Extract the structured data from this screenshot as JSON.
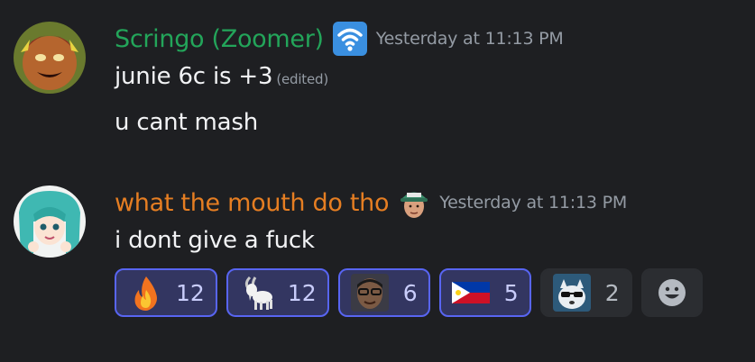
{
  "messages": [
    {
      "username": "Scringo (Zoomer)",
      "username_color": "#23a55a",
      "badge": "wifi-icon",
      "timestamp": "Yesterday at 11:13 PM",
      "lines": [
        "junie 6c is +3",
        "u cant mash"
      ],
      "edited_label": "(edited)"
    },
    {
      "username": "what the mouth do tho",
      "username_color": "#e67e22",
      "badge": "person-cap-icon",
      "timestamp": "Yesterday at 11:13 PM",
      "lines": [
        "i dont give a fuck"
      ]
    }
  ],
  "reactions": [
    {
      "emoji": "fire-emoji",
      "count": "12",
      "active": true
    },
    {
      "emoji": "goat-emoji",
      "count": "12",
      "active": true
    },
    {
      "emoji": "face-glasses-emoji",
      "count": "6",
      "active": true
    },
    {
      "emoji": "philippines-flag-emoji",
      "count": "5",
      "active": true
    },
    {
      "emoji": "cool-dog-emoji",
      "count": "2",
      "active": false
    }
  ],
  "add_reaction": "smile-icon"
}
